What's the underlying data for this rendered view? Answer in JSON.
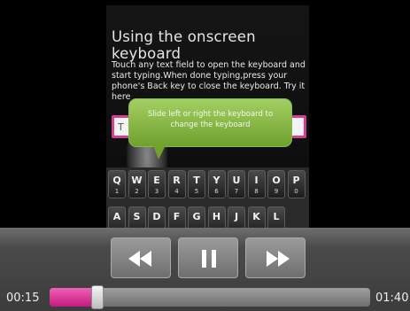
{
  "video": {
    "title": "Using the onscreen keyboard",
    "body": "Touch any text field to open the keyboard and start typing.When done typing,press your phone's Back key to close the keyboard. Try it here",
    "text_field_hint": "T"
  },
  "callout": {
    "text": "Slide left or right the keyboard to change the keyboard"
  },
  "keyboard": {
    "row1": [
      {
        "letter": "Q",
        "number": "1"
      },
      {
        "letter": "W",
        "number": "2"
      },
      {
        "letter": "E",
        "number": "3"
      },
      {
        "letter": "R",
        "number": "4"
      },
      {
        "letter": "T",
        "number": "5"
      },
      {
        "letter": "Y",
        "number": "6"
      },
      {
        "letter": "U",
        "number": "7"
      },
      {
        "letter": "I",
        "number": "8"
      },
      {
        "letter": "O",
        "number": "9"
      },
      {
        "letter": "P",
        "number": "0"
      }
    ],
    "row2": [
      "A",
      "S",
      "D",
      "F",
      "G",
      "H",
      "J",
      "K",
      "L"
    ]
  },
  "player": {
    "current_time": "00:15",
    "total_time": "01:40",
    "progress": 0.15,
    "rewind_icon": "rewind-icon",
    "pause_icon": "pause-icon",
    "forward_icon": "fast-forward-icon",
    "accent_color": "#d63c8f"
  }
}
